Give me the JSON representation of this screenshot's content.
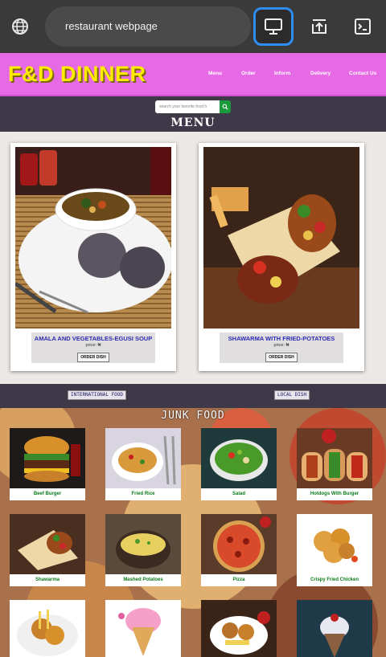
{
  "browser": {
    "url_text": "restaurant webpage"
  },
  "site": {
    "brand": "F&D DINNER",
    "nav": [
      "Menu",
      "Order",
      "Inform",
      "Delivery",
      "Contact Us"
    ],
    "search_placeholder": "search your favorite food h",
    "menu_heading": "MENU"
  },
  "cards": [
    {
      "title": "AMALA AND VEGETABLES-EGUSI SOUP",
      "price": "price: ₦",
      "button": "ORDER DISH"
    },
    {
      "title": "SHAWARMA WITH FRIED-POTATOES",
      "price": "price: ₦",
      "button": "ORDER DISH"
    }
  ],
  "categories": [
    "INTERNATIONAL FOOD",
    "LOCAL DISH"
  ],
  "junk": {
    "heading": "JUNK FOOD",
    "items": [
      "Beef Burger",
      "Fried Rice",
      "Salad",
      "Hotdogs With Burger",
      "Shawarma",
      "Mashed Potatoes",
      "Pizza",
      "Crispy Fried Chicken"
    ]
  },
  "colors": {
    "brand_bar": "#e66ae6",
    "brand_text": "#ffeb00",
    "dark_strip": "#3f3848",
    "label_green": "#0a7a1a",
    "card_title_blue": "#2b2bb3"
  }
}
